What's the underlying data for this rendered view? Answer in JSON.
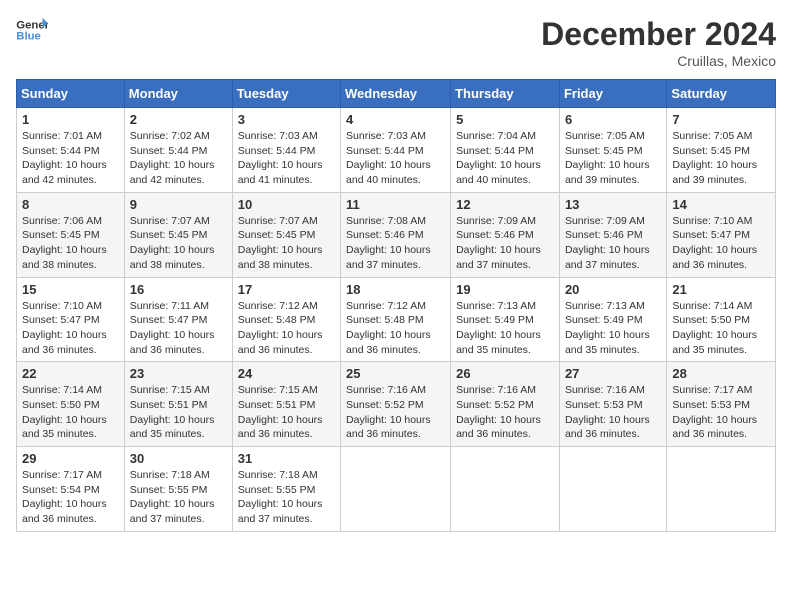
{
  "header": {
    "logo_line1": "General",
    "logo_line2": "Blue",
    "month": "December 2024",
    "location": "Cruillas, Mexico"
  },
  "weekdays": [
    "Sunday",
    "Monday",
    "Tuesday",
    "Wednesday",
    "Thursday",
    "Friday",
    "Saturday"
  ],
  "weeks": [
    [
      {
        "day": "1",
        "sunrise": "Sunrise: 7:01 AM",
        "sunset": "Sunset: 5:44 PM",
        "daylight": "Daylight: 10 hours and 42 minutes."
      },
      {
        "day": "2",
        "sunrise": "Sunrise: 7:02 AM",
        "sunset": "Sunset: 5:44 PM",
        "daylight": "Daylight: 10 hours and 42 minutes."
      },
      {
        "day": "3",
        "sunrise": "Sunrise: 7:03 AM",
        "sunset": "Sunset: 5:44 PM",
        "daylight": "Daylight: 10 hours and 41 minutes."
      },
      {
        "day": "4",
        "sunrise": "Sunrise: 7:03 AM",
        "sunset": "Sunset: 5:44 PM",
        "daylight": "Daylight: 10 hours and 40 minutes."
      },
      {
        "day": "5",
        "sunrise": "Sunrise: 7:04 AM",
        "sunset": "Sunset: 5:44 PM",
        "daylight": "Daylight: 10 hours and 40 minutes."
      },
      {
        "day": "6",
        "sunrise": "Sunrise: 7:05 AM",
        "sunset": "Sunset: 5:45 PM",
        "daylight": "Daylight: 10 hours and 39 minutes."
      },
      {
        "day": "7",
        "sunrise": "Sunrise: 7:05 AM",
        "sunset": "Sunset: 5:45 PM",
        "daylight": "Daylight: 10 hours and 39 minutes."
      }
    ],
    [
      {
        "day": "8",
        "sunrise": "Sunrise: 7:06 AM",
        "sunset": "Sunset: 5:45 PM",
        "daylight": "Daylight: 10 hours and 38 minutes."
      },
      {
        "day": "9",
        "sunrise": "Sunrise: 7:07 AM",
        "sunset": "Sunset: 5:45 PM",
        "daylight": "Daylight: 10 hours and 38 minutes."
      },
      {
        "day": "10",
        "sunrise": "Sunrise: 7:07 AM",
        "sunset": "Sunset: 5:45 PM",
        "daylight": "Daylight: 10 hours and 38 minutes."
      },
      {
        "day": "11",
        "sunrise": "Sunrise: 7:08 AM",
        "sunset": "Sunset: 5:46 PM",
        "daylight": "Daylight: 10 hours and 37 minutes."
      },
      {
        "day": "12",
        "sunrise": "Sunrise: 7:09 AM",
        "sunset": "Sunset: 5:46 PM",
        "daylight": "Daylight: 10 hours and 37 minutes."
      },
      {
        "day": "13",
        "sunrise": "Sunrise: 7:09 AM",
        "sunset": "Sunset: 5:46 PM",
        "daylight": "Daylight: 10 hours and 37 minutes."
      },
      {
        "day": "14",
        "sunrise": "Sunrise: 7:10 AM",
        "sunset": "Sunset: 5:47 PM",
        "daylight": "Daylight: 10 hours and 36 minutes."
      }
    ],
    [
      {
        "day": "15",
        "sunrise": "Sunrise: 7:10 AM",
        "sunset": "Sunset: 5:47 PM",
        "daylight": "Daylight: 10 hours and 36 minutes."
      },
      {
        "day": "16",
        "sunrise": "Sunrise: 7:11 AM",
        "sunset": "Sunset: 5:47 PM",
        "daylight": "Daylight: 10 hours and 36 minutes."
      },
      {
        "day": "17",
        "sunrise": "Sunrise: 7:12 AM",
        "sunset": "Sunset: 5:48 PM",
        "daylight": "Daylight: 10 hours and 36 minutes."
      },
      {
        "day": "18",
        "sunrise": "Sunrise: 7:12 AM",
        "sunset": "Sunset: 5:48 PM",
        "daylight": "Daylight: 10 hours and 36 minutes."
      },
      {
        "day": "19",
        "sunrise": "Sunrise: 7:13 AM",
        "sunset": "Sunset: 5:49 PM",
        "daylight": "Daylight: 10 hours and 35 minutes."
      },
      {
        "day": "20",
        "sunrise": "Sunrise: 7:13 AM",
        "sunset": "Sunset: 5:49 PM",
        "daylight": "Daylight: 10 hours and 35 minutes."
      },
      {
        "day": "21",
        "sunrise": "Sunrise: 7:14 AM",
        "sunset": "Sunset: 5:50 PM",
        "daylight": "Daylight: 10 hours and 35 minutes."
      }
    ],
    [
      {
        "day": "22",
        "sunrise": "Sunrise: 7:14 AM",
        "sunset": "Sunset: 5:50 PM",
        "daylight": "Daylight: 10 hours and 35 minutes."
      },
      {
        "day": "23",
        "sunrise": "Sunrise: 7:15 AM",
        "sunset": "Sunset: 5:51 PM",
        "daylight": "Daylight: 10 hours and 35 minutes."
      },
      {
        "day": "24",
        "sunrise": "Sunrise: 7:15 AM",
        "sunset": "Sunset: 5:51 PM",
        "daylight": "Daylight: 10 hours and 36 minutes."
      },
      {
        "day": "25",
        "sunrise": "Sunrise: 7:16 AM",
        "sunset": "Sunset: 5:52 PM",
        "daylight": "Daylight: 10 hours and 36 minutes."
      },
      {
        "day": "26",
        "sunrise": "Sunrise: 7:16 AM",
        "sunset": "Sunset: 5:52 PM",
        "daylight": "Daylight: 10 hours and 36 minutes."
      },
      {
        "day": "27",
        "sunrise": "Sunrise: 7:16 AM",
        "sunset": "Sunset: 5:53 PM",
        "daylight": "Daylight: 10 hours and 36 minutes."
      },
      {
        "day": "28",
        "sunrise": "Sunrise: 7:17 AM",
        "sunset": "Sunset: 5:53 PM",
        "daylight": "Daylight: 10 hours and 36 minutes."
      }
    ],
    [
      {
        "day": "29",
        "sunrise": "Sunrise: 7:17 AM",
        "sunset": "Sunset: 5:54 PM",
        "daylight": "Daylight: 10 hours and 36 minutes."
      },
      {
        "day": "30",
        "sunrise": "Sunrise: 7:18 AM",
        "sunset": "Sunset: 5:55 PM",
        "daylight": "Daylight: 10 hours and 37 minutes."
      },
      {
        "day": "31",
        "sunrise": "Sunrise: 7:18 AM",
        "sunset": "Sunset: 5:55 PM",
        "daylight": "Daylight: 10 hours and 37 minutes."
      },
      null,
      null,
      null,
      null
    ]
  ]
}
